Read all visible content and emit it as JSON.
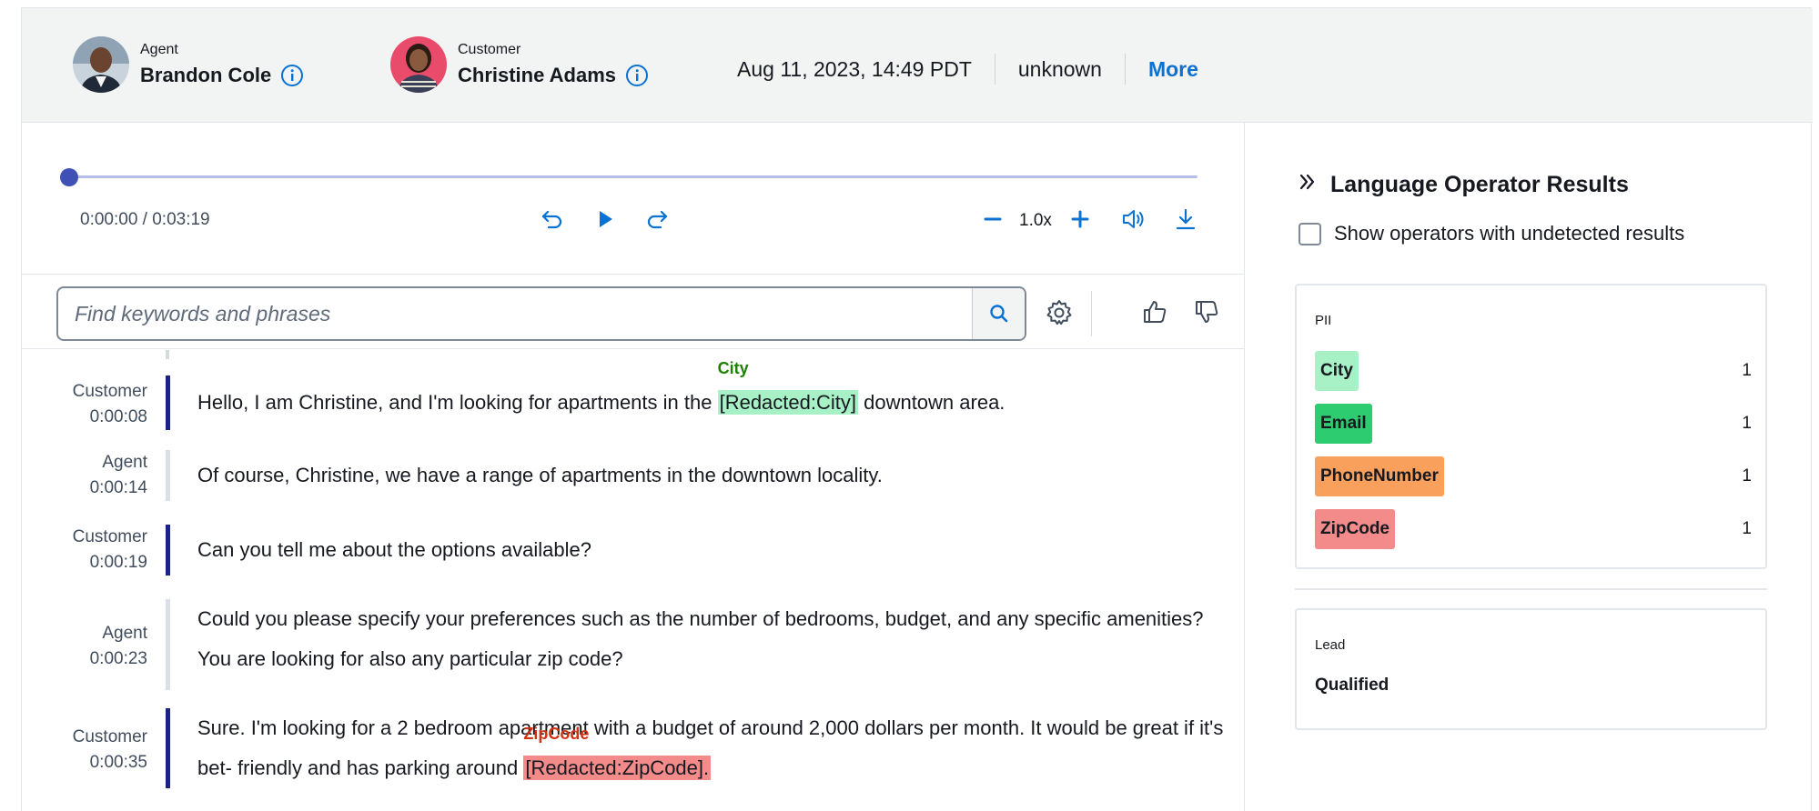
{
  "header": {
    "agent": {
      "role": "Agent",
      "name": "Brandon Cole"
    },
    "customer": {
      "role": "Customer",
      "name": "Christine Adams"
    },
    "datetime": "Aug 11, 2023, 14:49 PDT",
    "status": "unknown",
    "more_label": "More"
  },
  "player": {
    "time": "0:00:00 / 0:03:19",
    "speed": "1.0x",
    "progress": 0.0
  },
  "search": {
    "placeholder": "Find keywords and phrases"
  },
  "transcript": [
    {
      "speaker": "Customer",
      "time": "0:00:08",
      "before": "Hello, I am Christine, and I'm looking for apartments in the ",
      "redacted": "[Redacted:City]",
      "tag": "City",
      "after": " downtown area."
    },
    {
      "speaker": "Agent",
      "time": "0:00:14",
      "text": "Of course, Christine, we have a range of apartments in the downtown locality."
    },
    {
      "speaker": "Customer",
      "time": "0:00:19",
      "text": "Can you tell me about the options available?"
    },
    {
      "speaker": "Agent",
      "time": "0:00:23",
      "text": "Could you please specify your preferences such as the number of bedrooms, budget, and any specific amenities? You are looking for also any particular zip code?"
    },
    {
      "speaker": "Customer",
      "time": "0:00:35",
      "before": "Sure. I'm looking for a 2 bedroom apartment with a budget of around 2,000 dollars per month. It would be great if it's bet- friendly and has parking around ",
      "redacted": "[Redacted:ZipCode].",
      "tag": "ZipCode",
      "after": ""
    }
  ],
  "operators": {
    "title": "Language Operator Results",
    "show_undetected_label": "Show operators with undetected results",
    "pii": {
      "title": "PII",
      "items": [
        {
          "label": "City",
          "count": "1",
          "color": "#a8f0c6"
        },
        {
          "label": "Email",
          "count": "1",
          "color": "#2ecc71"
        },
        {
          "label": "PhoneNumber",
          "count": "1",
          "color": "#f8a05c"
        },
        {
          "label": "ZipCode",
          "count": "1",
          "color": "#f48b8b"
        }
      ]
    },
    "lead": {
      "title": "Lead",
      "value": "Qualified"
    }
  }
}
